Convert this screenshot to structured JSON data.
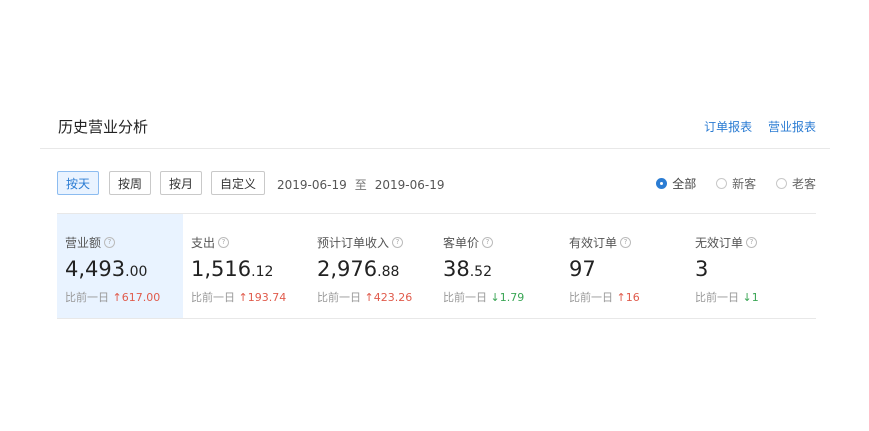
{
  "header": {
    "title": "历史营业分析",
    "links": [
      "订单报表",
      "营业报表"
    ]
  },
  "filters": {
    "periods": [
      "按天",
      "按周",
      "按月",
      "自定义"
    ],
    "active_period": "按天",
    "date_from": "2019-06-19",
    "date_sep": "至",
    "date_to": "2019-06-19",
    "customer_types": [
      "全部",
      "新客",
      "老客"
    ],
    "selected_customer_type": "全部"
  },
  "metrics": [
    {
      "label": "营业额",
      "int": "4,493",
      "dec": ".00",
      "compare_label": "比前一日",
      "arrow": "↑",
      "delta": "617.00",
      "dir": "up",
      "active": true
    },
    {
      "label": "支出",
      "int": "1,516",
      "dec": ".12",
      "compare_label": "比前一日",
      "arrow": "↑",
      "delta": "193.74",
      "dir": "up",
      "active": false
    },
    {
      "label": "预计订单收入",
      "int": "2,976",
      "dec": ".88",
      "compare_label": "比前一日",
      "arrow": "↑",
      "delta": "423.26",
      "dir": "up",
      "active": false
    },
    {
      "label": "客单价",
      "int": "38",
      "dec": ".52",
      "compare_label": "比前一日",
      "arrow": "↓",
      "delta": "1.79",
      "dir": "down",
      "active": false
    },
    {
      "label": "有效订单",
      "int": "97",
      "dec": "",
      "compare_label": "比前一日",
      "arrow": "↑",
      "delta": "16",
      "dir": "up",
      "active": false
    },
    {
      "label": "无效订单",
      "int": "3",
      "dec": "",
      "compare_label": "比前一日",
      "arrow": "↓",
      "delta": "1",
      "dir": "down",
      "active": false
    }
  ],
  "icons": {
    "help": "?"
  }
}
